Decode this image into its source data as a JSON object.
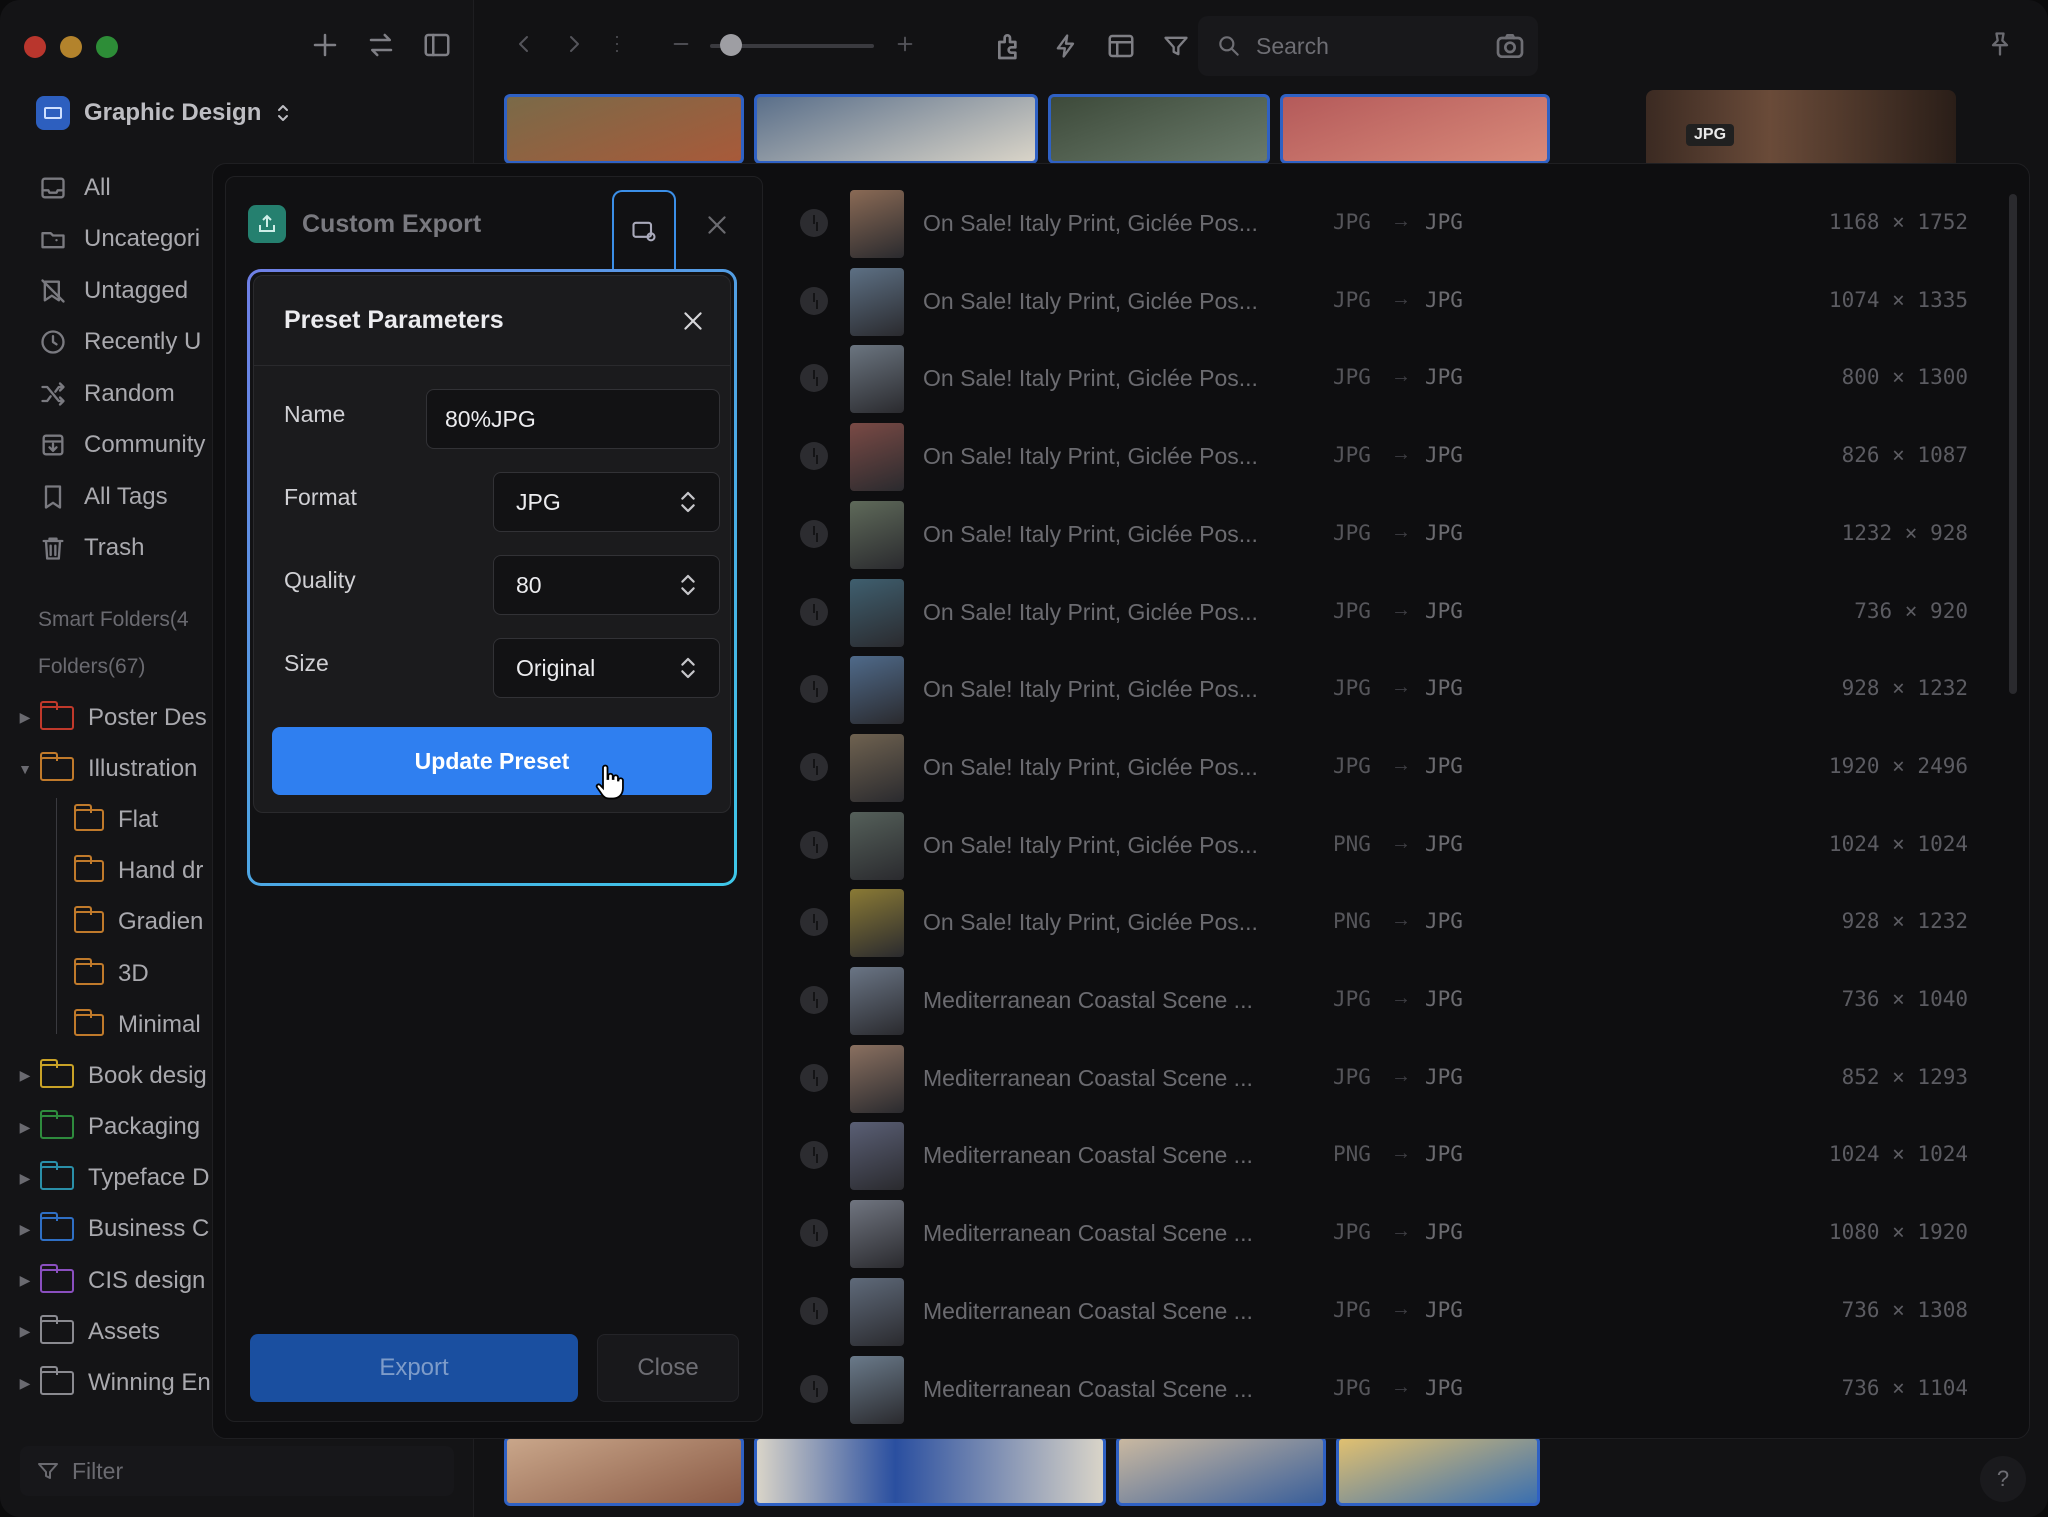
{
  "library": {
    "name": "Graphic Design"
  },
  "sidebar": {
    "items": [
      {
        "label": "All",
        "icon": "inbox-icon"
      },
      {
        "label": "Uncategori",
        "icon": "folder-question-icon"
      },
      {
        "label": "Untagged",
        "icon": "tag-off-icon"
      },
      {
        "label": "Recently U",
        "icon": "clock-icon"
      },
      {
        "label": "Random",
        "icon": "shuffle-icon"
      },
      {
        "label": "Community",
        "icon": "download-box-icon"
      },
      {
        "label": "All Tags",
        "icon": "bookmark-icon"
      },
      {
        "label": "Trash",
        "icon": "trash-icon"
      }
    ],
    "smart_folders": "Smart Folders(4",
    "folders_header": "Folders(67)",
    "folders": [
      {
        "label": "Poster Des",
        "color": "#c0392b",
        "expanded": false,
        "child": false
      },
      {
        "label": "Illustration",
        "color": "#c07a2b",
        "expanded": true,
        "child": false
      },
      {
        "label": "Flat",
        "color": "#c07a2b",
        "child": true
      },
      {
        "label": "Hand dr",
        "color": "#c07a2b",
        "child": true
      },
      {
        "label": "Gradien",
        "color": "#c07a2b",
        "child": true
      },
      {
        "label": "3D",
        "color": "#c07a2b",
        "child": true
      },
      {
        "label": "Minimal",
        "color": "#c07a2b",
        "child": true
      },
      {
        "label": "Book desig",
        "color": "#c9a227",
        "expanded": false,
        "child": false
      },
      {
        "label": "Packaging",
        "color": "#2e8b3d",
        "expanded": false,
        "child": false
      },
      {
        "label": "Typeface D",
        "color": "#2a8fa8",
        "expanded": false,
        "child": false
      },
      {
        "label": "Business C",
        "color": "#2f6fc4",
        "expanded": false,
        "child": false
      },
      {
        "label": "CIS design",
        "color": "#8a4fbf",
        "expanded": false,
        "child": false
      },
      {
        "label": "Assets",
        "color": "#8a8a90",
        "expanded": false,
        "child": false
      },
      {
        "label": "Winning En",
        "color": "#8a8a90",
        "expanded": false,
        "child": false
      }
    ],
    "filter_placeholder": "Filter"
  },
  "toolbar": {
    "search_placeholder": "Search"
  },
  "inspector": {
    "badge": "JPG"
  },
  "export_panel": {
    "title": "Custom Export",
    "export_label": "Export",
    "close_label": "Close"
  },
  "preset_popover": {
    "title": "Preset Parameters",
    "name_label": "Name",
    "name_value": "80%JPG",
    "format_label": "Format",
    "format_value": "JPG",
    "quality_label": "Quality",
    "quality_value": "80",
    "size_label": "Size",
    "size_value": "Original",
    "update_label": "Update Preset"
  },
  "files": [
    {
      "name": "On Sale! Italy Print, Giclée Pos...",
      "src": "JPG",
      "dst": "JPG",
      "dims": "1168 × 1752",
      "thumb": "#8a6a55"
    },
    {
      "name": "On Sale! Italy Print, Giclée Pos...",
      "src": "JPG",
      "dst": "JPG",
      "dims": "1074 × 1335",
      "thumb": "#5d7084"
    },
    {
      "name": "On Sale! Italy Print, Giclée Pos...",
      "src": "JPG",
      "dst": "JPG",
      "dims": "800 × 1300",
      "thumb": "#6b7580"
    },
    {
      "name": "On Sale! Italy Print, Giclée Pos...",
      "src": "JPG",
      "dst": "JPG",
      "dims": "826 × 1087",
      "thumb": "#7a4a45"
    },
    {
      "name": "On Sale! Italy Print, Giclée Pos...",
      "src": "JPG",
      "dst": "JPG",
      "dims": "1232 × 928",
      "thumb": "#5f6a5a"
    },
    {
      "name": "On Sale! Italy Print, Giclée Pos...",
      "src": "JPG",
      "dst": "JPG",
      "dims": "736 × 920",
      "thumb": "#3f5f6f"
    },
    {
      "name": "On Sale! Italy Print, Giclée Pos...",
      "src": "JPG",
      "dst": "JPG",
      "dims": "928 × 1232",
      "thumb": "#4f6a8a"
    },
    {
      "name": "On Sale! Italy Print, Giclée Pos...",
      "src": "JPG",
      "dst": "JPG",
      "dims": "1920 × 2496",
      "thumb": "#6f6250"
    },
    {
      "name": "On Sale! Italy Print, Giclée Pos...",
      "src": "PNG",
      "dst": "JPG",
      "dims": "1024 × 1024",
      "thumb": "#55605a"
    },
    {
      "name": "On Sale! Italy Print, Giclée Pos...",
      "src": "PNG",
      "dst": "JPG",
      "dims": "928 × 1232",
      "thumb": "#8a7a35"
    },
    {
      "name": "Mediterranean Coastal Scene ...",
      "src": "JPG",
      "dst": "JPG",
      "dims": "736 × 1040",
      "thumb": "#6a7585"
    },
    {
      "name": "Mediterranean Coastal Scene ...",
      "src": "JPG",
      "dst": "JPG",
      "dims": "852 × 1293",
      "thumb": "#8a7060"
    },
    {
      "name": "Mediterranean Coastal Scene ...",
      "src": "PNG",
      "dst": "JPG",
      "dims": "1024 × 1024",
      "thumb": "#5a5f75"
    },
    {
      "name": "Mediterranean Coastal Scene ...",
      "src": "JPG",
      "dst": "JPG",
      "dims": "1080 × 1920",
      "thumb": "#707580"
    },
    {
      "name": "Mediterranean Coastal Scene ...",
      "src": "JPG",
      "dst": "JPG",
      "dims": "736 × 1308",
      "thumb": "#5f6a7a"
    },
    {
      "name": "Mediterranean Coastal Scene ...",
      "src": "JPG",
      "dst": "JPG",
      "dims": "736 × 1104",
      "thumb": "#6a7a8a"
    }
  ],
  "colors": {
    "accent": "#2f7ff0",
    "selection_border": "#2f61c4"
  },
  "help_label": "?"
}
